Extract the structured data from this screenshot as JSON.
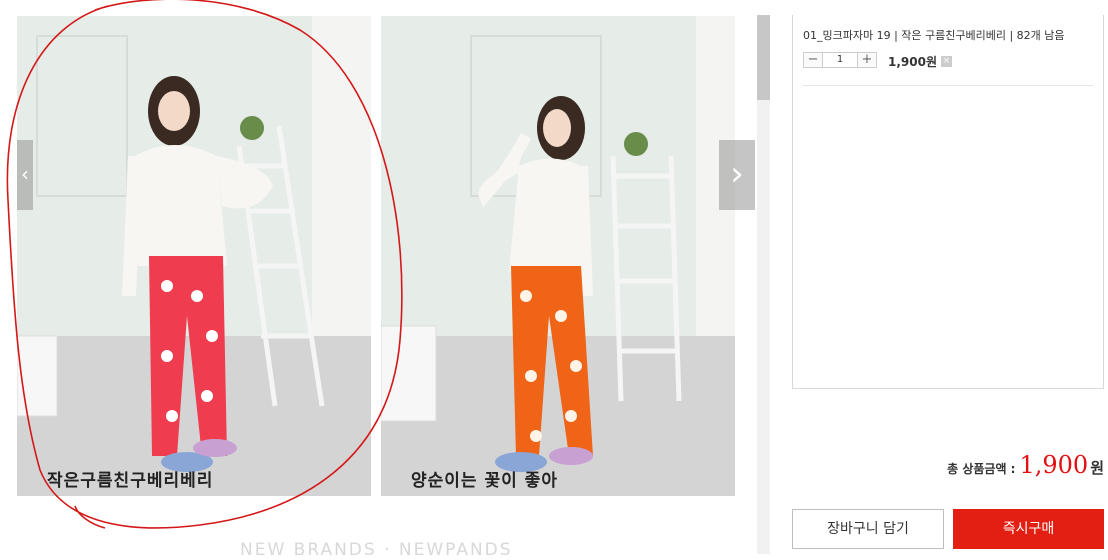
{
  "gallery": {
    "items": [
      {
        "caption": "작은구름친구베리베리"
      },
      {
        "caption": "양순이는 꽃이 좋아"
      }
    ],
    "footer_text": "NEW BRANDS · NEWPANDS"
  },
  "option": {
    "name": "01_밍크파자마 19 | 작은 구름친구베리베리 | 82개 남음",
    "quantity": "1",
    "minus": "−",
    "plus": "+",
    "price": "1,900원",
    "remove": "×"
  },
  "total": {
    "label": "총 상품금액 :",
    "value": "1,900",
    "unit": "원"
  },
  "buttons": {
    "cart": "장바구니 담기",
    "buy": "즉시구매"
  },
  "colors": {
    "accent": "#e31e12",
    "price": "#e20f13"
  }
}
